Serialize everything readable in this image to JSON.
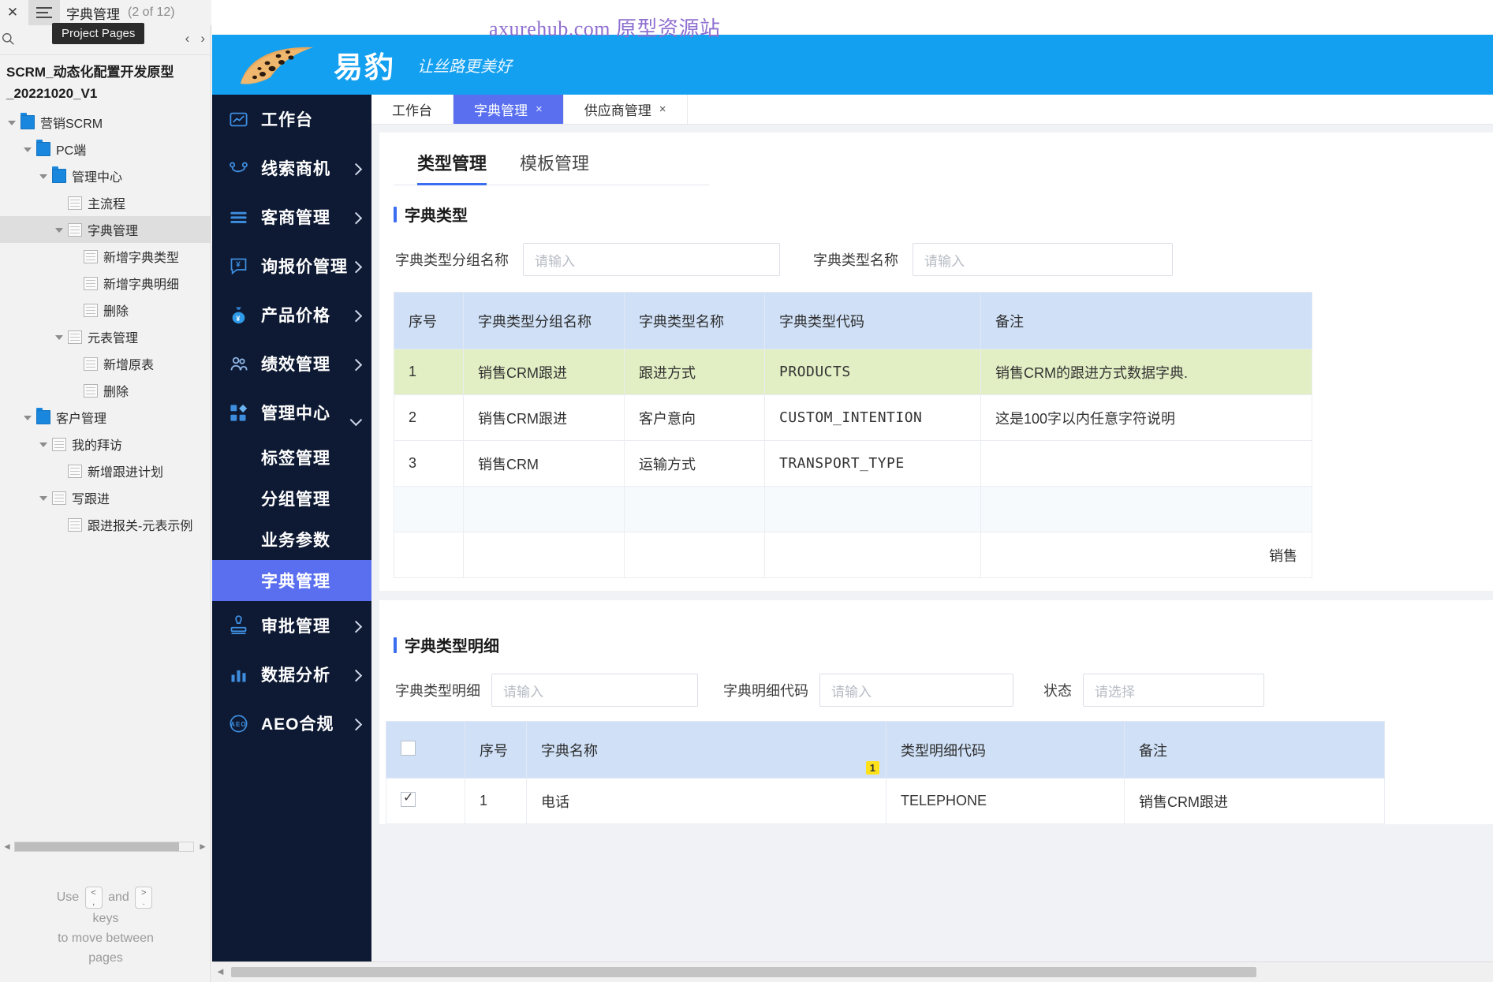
{
  "axure": {
    "close_label": "✕",
    "page_title": "字典管理",
    "page_count": "(2 of 12)",
    "tooltip": "Project Pages",
    "project_name": "SCRM_动态化配置开发原型_20221020_V1",
    "hint_use": "Use",
    "hint_and": "and",
    "hint_keys": "keys",
    "hint_move": "to move between",
    "hint_pages": "pages",
    "key_prev_top": "<",
    "key_prev_bottom": ",",
    "key_next_top": ">",
    "key_next_bottom": ".",
    "tree": [
      {
        "label": "营销SCRM",
        "type": "folder",
        "depth": 0,
        "caret": true,
        "selected": false
      },
      {
        "label": "PC端",
        "type": "folder",
        "depth": 1,
        "caret": true,
        "selected": false
      },
      {
        "label": "管理中心",
        "type": "folder",
        "depth": 2,
        "caret": true,
        "selected": false
      },
      {
        "label": "主流程",
        "type": "page",
        "depth": 3,
        "caret": false,
        "selected": false
      },
      {
        "label": "字典管理",
        "type": "page",
        "depth": 3,
        "caret": true,
        "selected": true
      },
      {
        "label": "新增字典类型",
        "type": "page",
        "depth": 4,
        "caret": false,
        "selected": false
      },
      {
        "label": "新增字典明细",
        "type": "page",
        "depth": 4,
        "caret": false,
        "selected": false
      },
      {
        "label": "删除",
        "type": "page",
        "depth": 4,
        "caret": false,
        "selected": false
      },
      {
        "label": "元表管理",
        "type": "page",
        "depth": 3,
        "caret": true,
        "selected": false
      },
      {
        "label": "新增原表",
        "type": "page",
        "depth": 4,
        "caret": false,
        "selected": false
      },
      {
        "label": "删除",
        "type": "page",
        "depth": 4,
        "caret": false,
        "selected": false
      },
      {
        "label": "客户管理",
        "type": "folder",
        "depth": 1,
        "caret": true,
        "selected": false
      },
      {
        "label": "我的拜访",
        "type": "page",
        "depth": 2,
        "caret": true,
        "selected": false
      },
      {
        "label": "新增跟进计划",
        "type": "page",
        "depth": 3,
        "caret": false,
        "selected": false
      },
      {
        "label": "写跟进",
        "type": "page",
        "depth": 2,
        "caret": true,
        "selected": false
      },
      {
        "label": "跟进报关-元表示例",
        "type": "page",
        "depth": 3,
        "caret": false,
        "selected": false
      }
    ]
  },
  "watermark": "axurehub.com 原型资源站",
  "brand": {
    "name": "易豹",
    "slogan": "让丝路更美好"
  },
  "prototype_tabs": [
    {
      "label": "工作台",
      "active": false,
      "closable": false
    },
    {
      "label": "字典管理",
      "active": true,
      "closable": true,
      "close": "×"
    },
    {
      "label": "供应商管理",
      "active": false,
      "closable": true,
      "close": "×"
    }
  ],
  "nav": [
    {
      "label": "工作台",
      "icon": "dashboard-icon",
      "chevron": false
    },
    {
      "label": "线索商机",
      "icon": "lead-icon",
      "chevron": true
    },
    {
      "label": "客商管理",
      "icon": "list-icon",
      "chevron": true
    },
    {
      "label": "询报价管理",
      "icon": "quote-icon",
      "chevron": true
    },
    {
      "label": "产品价格",
      "icon": "money-bag-icon",
      "chevron": true
    },
    {
      "label": "绩效管理",
      "icon": "people-icon",
      "chevron": true
    },
    {
      "label": "管理中心",
      "icon": "grid-icon",
      "chevron": true,
      "expanded": true
    }
  ],
  "nav_sub": [
    {
      "label": "标签管理",
      "active": false
    },
    {
      "label": "分组管理",
      "active": false
    },
    {
      "label": "业务参数",
      "active": false
    },
    {
      "label": "字典管理",
      "active": true
    }
  ],
  "nav_after": [
    {
      "label": "审批管理",
      "icon": "stamp-icon",
      "chevron": true
    },
    {
      "label": "数据分析",
      "icon": "bar-chart-icon",
      "chevron": true
    },
    {
      "label": "AEO合规",
      "icon": "aeo-icon",
      "chevron": true
    }
  ],
  "content": {
    "subtabs": [
      {
        "label": "类型管理",
        "active": true
      },
      {
        "label": "模板管理",
        "active": false
      }
    ],
    "type_section": {
      "title": "字典类型",
      "filters": [
        {
          "label": "字典类型分组名称",
          "placeholder": "请输入",
          "value": ""
        },
        {
          "label": "字典类型名称",
          "placeholder": "请输入",
          "value": ""
        }
      ],
      "columns": [
        "序号",
        "字典类型分组名称",
        "字典类型名称",
        "字典类型代码",
        "备注"
      ],
      "rows": [
        {
          "cells": [
            "1",
            "销售CRM跟进",
            "跟进方式",
            "PRODUCTS",
            "销售CRM的跟进方式数据字典."
          ],
          "highlight": true
        },
        {
          "cells": [
            "2",
            "销售CRM跟进",
            "客户意向",
            "CUSTOM_INTENTION",
            "这是100字以内任意字符说明"
          ],
          "highlight": false
        },
        {
          "cells": [
            "3",
            "销售CRM",
            "运输方式",
            "TRANSPORT_TYPE",
            ""
          ],
          "highlight": false
        },
        {
          "cells": [
            "",
            "",
            "",
            "",
            ""
          ],
          "highlight": false,
          "blank": true
        },
        {
          "cells": [
            "",
            "",
            "",
            "",
            "销售"
          ],
          "highlight": false,
          "rightalign": true
        }
      ]
    },
    "detail_section": {
      "title": "字典类型明细",
      "filters": [
        {
          "label": "字典类型明细",
          "placeholder": "请输入",
          "value": ""
        },
        {
          "label": "字典明细代码",
          "placeholder": "请输入",
          "value": ""
        },
        {
          "label": "状态",
          "placeholder": "请选择",
          "value": ""
        }
      ],
      "columns": [
        "",
        "序号",
        "字典名称",
        "类型明细代码",
        "备注"
      ],
      "rows": [
        {
          "checked": true,
          "cells": [
            "1",
            "电话",
            "TELEPHONE",
            "销售CRM跟进"
          ],
          "badge": "1"
        }
      ]
    }
  }
}
